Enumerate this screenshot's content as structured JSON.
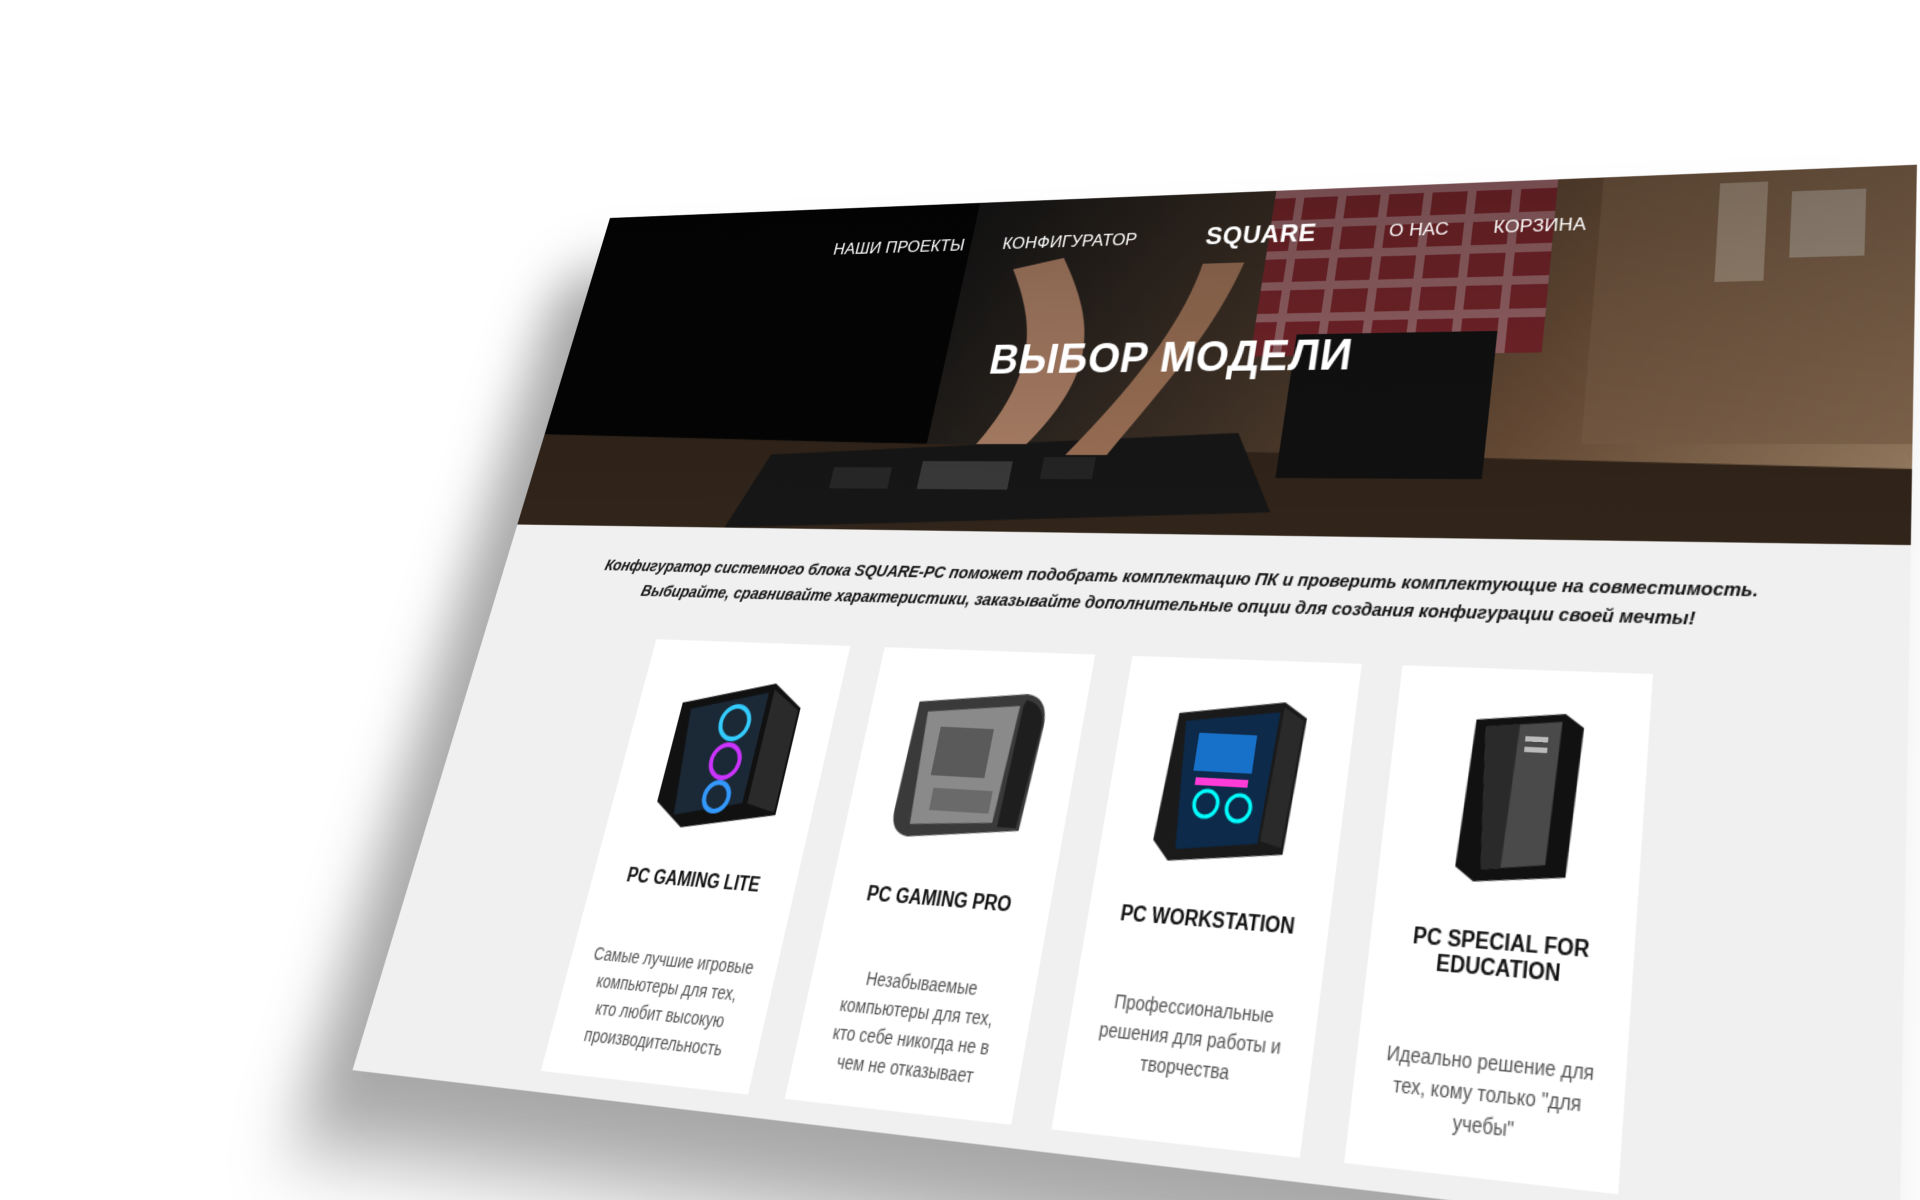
{
  "nav": {
    "projects": "НАШИ ПРОЕКТЫ",
    "configurator": "КОНФИГУРАТОР",
    "logo": "SQUARE",
    "about": "О НАС",
    "cart": "КОРЗИНА"
  },
  "hero": {
    "title": "ВЫБОР МОДЕЛИ"
  },
  "intro": {
    "line1": "Конфигуратор системного блока SQUARE-PC поможет подобрать комплектацию ПК и проверить комплектующие на совместимость.",
    "line2": "Выбирайте, сравнивайте характеристики, заказывайте дополнительные опции для создания конфигурации своей мечты!"
  },
  "cards": [
    {
      "title": "PC GAMING LITE",
      "desc": "Самые лучшие игровые компьютеры для тех, кто любит высокую производительность",
      "image_icon": "gaming-lite-case-icon"
    },
    {
      "title": "PC GAMING PRO",
      "desc": "Незабываемые компьютеры для тех, кто себе никогда не в чем не отказывает",
      "image_icon": "gaming-pro-case-icon"
    },
    {
      "title": "PC WORKSTATION",
      "desc": "Профессиональные решения для работы и творчества",
      "image_icon": "workstation-case-icon"
    },
    {
      "title": "PC SPECIAL FOR EDUCATION",
      "desc": "Идеально решение для тех, кому только \"для учебы\"",
      "image_icon": "education-case-icon"
    }
  ]
}
